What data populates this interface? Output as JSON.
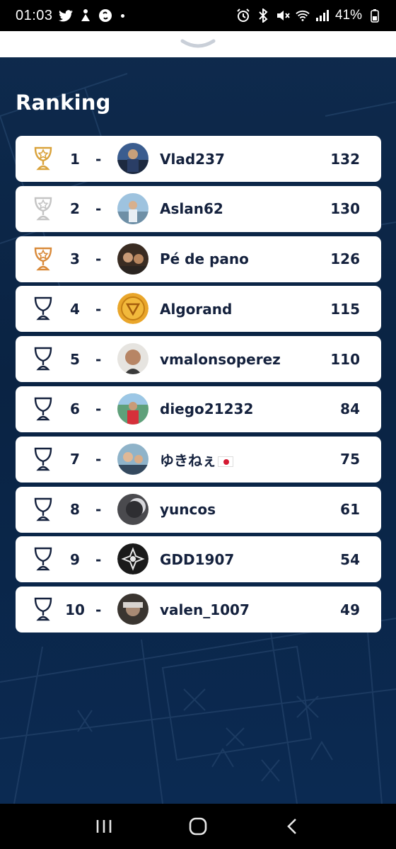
{
  "status_bar": {
    "time": "01:03",
    "battery": "41%",
    "left_icons": [
      "twitter-icon",
      "notification-icon",
      "shazam-icon",
      "dot-icon"
    ],
    "right_icons": [
      "alarm-icon",
      "bluetooth-icon",
      "mute-icon",
      "wifi-icon",
      "signal-icon"
    ]
  },
  "page": {
    "title": "Ranking"
  },
  "colors": {
    "gold": "#d9a23a",
    "silver": "#c4c4c4",
    "bronze": "#d98a3a",
    "dark_text": "#14213d",
    "background": "#0b2646"
  },
  "ranking": [
    {
      "position": "1",
      "dash": "-",
      "name": "Vlad237",
      "score": "132",
      "trophy": "gold"
    },
    {
      "position": "2",
      "dash": "-",
      "name": "Aslan62",
      "score": "130",
      "trophy": "silver"
    },
    {
      "position": "3",
      "dash": "-",
      "name": "Pé de pano",
      "score": "126",
      "trophy": "bronze"
    },
    {
      "position": "4",
      "dash": "-",
      "name": "Algorand",
      "score": "115",
      "trophy": "plain"
    },
    {
      "position": "5",
      "dash": "-",
      "name": "vmalonsoperez",
      "score": "110",
      "trophy": "plain"
    },
    {
      "position": "6",
      "dash": "-",
      "name": "diego21232",
      "score": "84",
      "trophy": "plain"
    },
    {
      "position": "7",
      "dash": "-",
      "name": "ゆきねぇ",
      "score": "75",
      "trophy": "plain"
    },
    {
      "position": "8",
      "dash": "-",
      "name": "yuncos",
      "score": "61",
      "trophy": "plain"
    },
    {
      "position": "9",
      "dash": "-",
      "name": "GDD1907",
      "score": "54",
      "trophy": "plain"
    },
    {
      "position": "10",
      "dash": "-",
      "name": "valen_1007",
      "score": "49",
      "trophy": "plain"
    }
  ],
  "nav_bar": {
    "buttons": [
      "recent-apps-icon",
      "home-icon",
      "back-icon"
    ]
  }
}
